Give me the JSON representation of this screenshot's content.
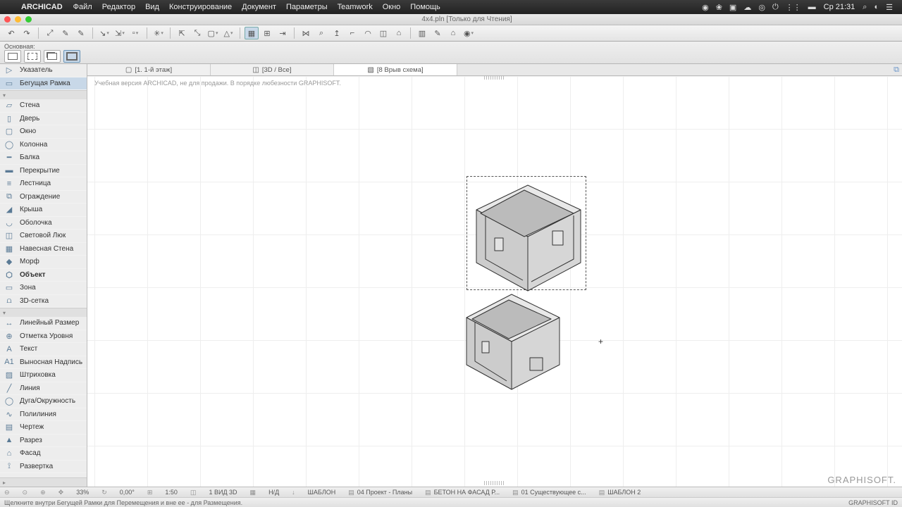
{
  "menu": {
    "app": "ARCHICAD",
    "items": [
      "Файл",
      "Редактор",
      "Вид",
      "Конструирование",
      "Документ",
      "Параметры",
      "Teamwork",
      "Окно",
      "Помощь"
    ],
    "clock": "Ср 21:31"
  },
  "title": "4x4.pln  [Только для Чтения]",
  "subbar": {
    "label": "Основная:"
  },
  "tools": {
    "sel": [
      {
        "ic": "▷",
        "label": "Указатель"
      },
      {
        "ic": "▭",
        "label": "Бегущая Рамка",
        "sel": true
      }
    ],
    "design": [
      {
        "ic": "▱",
        "label": "Стена"
      },
      {
        "ic": "▯",
        "label": "Дверь"
      },
      {
        "ic": "▢",
        "label": "Окно"
      },
      {
        "ic": "◯",
        "label": "Колонна"
      },
      {
        "ic": "━",
        "label": "Балка"
      },
      {
        "ic": "▬",
        "label": "Перекрытие"
      },
      {
        "ic": "≡",
        "label": "Лестница"
      },
      {
        "ic": "⧉",
        "label": "Ограждение"
      },
      {
        "ic": "◢",
        "label": "Крыша"
      },
      {
        "ic": "◡",
        "label": "Оболочка"
      },
      {
        "ic": "◫",
        "label": "Световой Люк"
      },
      {
        "ic": "▦",
        "label": "Навесная Стена"
      },
      {
        "ic": "◆",
        "label": "Морф"
      },
      {
        "ic": "⬡",
        "label": "Объект",
        "bold": true
      },
      {
        "ic": "▭",
        "label": "Зона"
      },
      {
        "ic": "⩍",
        "label": "3D-сетка"
      }
    ],
    "doc": [
      {
        "ic": "↔",
        "label": "Линейный Размер"
      },
      {
        "ic": "⊕",
        "label": "Отметка Уровня"
      },
      {
        "ic": "A",
        "label": "Текст"
      },
      {
        "ic": "A1",
        "label": "Выносная Надпись"
      },
      {
        "ic": "▨",
        "label": "Штриховка"
      },
      {
        "ic": "╱",
        "label": "Линия"
      },
      {
        "ic": "◯",
        "label": "Дуга/Окружность"
      },
      {
        "ic": "∿",
        "label": "Полилиния"
      },
      {
        "ic": "▤",
        "label": "Чертеж"
      },
      {
        "ic": "▲",
        "label": "Разрез"
      },
      {
        "ic": "⌂",
        "label": "Фасад"
      },
      {
        "ic": "⟟",
        "label": "Развертка"
      }
    ]
  },
  "tabs": [
    {
      "ic": "▢",
      "label": "[1. 1-й этаж]"
    },
    {
      "ic": "◫",
      "label": "[3D / Все]"
    },
    {
      "ic": "▧",
      "label": "[8 Врыв схема]",
      "active": true
    }
  ],
  "watermark": "Учебная версия ARCHICAD, не для продажи. В порядке любезности GRAPHISOFT.",
  "brand": "GRAPHISOFT.",
  "status": {
    "zoom": "33%",
    "angle": "0,00°",
    "scale": "1:50",
    "view": "1 ВИД 3D",
    "nd": "Н/Д",
    "layer": "ШАБЛОН",
    "v1": "04 Проект - Планы",
    "v2": "БЕТОН НА ФАСАД Р...",
    "v3": "01 Существующее с...",
    "v4": "ШАБЛОН 2",
    "hint": "Щелкните внутри Бегущей Рамки для Перемещения и вне ее - для Размещения.",
    "gs": "GRAPHISOFT ID"
  }
}
